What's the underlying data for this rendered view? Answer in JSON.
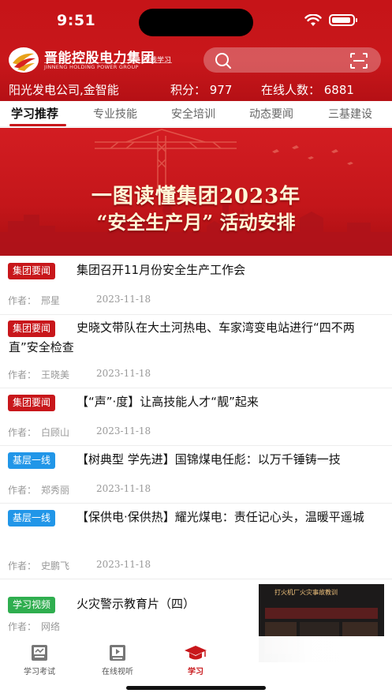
{
  "status_bar": {
    "time": "9:51"
  },
  "header": {
    "brand_name": "晋能控股电力集团",
    "brand_en": "JINNENG HOLDING POWER GROUP",
    "brand_tag": "在线学习",
    "company_user": "阳光发电公司,金智能",
    "points": "积分：  977",
    "online": "在线人数：  6881"
  },
  "tabs": [
    {
      "label": "学习推荐",
      "active": true
    },
    {
      "label": "专业技能",
      "active": false
    },
    {
      "label": "安全培训",
      "active": false
    },
    {
      "label": "动态要闻",
      "active": false
    },
    {
      "label": "三基建设",
      "active": false
    }
  ],
  "banner": {
    "title": "一图读懂集团2023年",
    "subtitle": "“安全生产月” 活动安排"
  },
  "news": [
    {
      "tag": "集团要闻",
      "tag_color": "#c8171b",
      "title": "集团召开11月份安全生产工作会",
      "author_label": "作者：",
      "author": "邢星",
      "date": "2023-11-18"
    },
    {
      "tag": "集团要闻",
      "tag_color": "#c8171b",
      "title": "史晓文带队在大土河热电、车家湾变电站进行“四不两直”安全检查",
      "author_label": "作者：",
      "author": "王晓美",
      "date": "2023-11-18"
    },
    {
      "tag": "集团要闻",
      "tag_color": "#c8171b",
      "title": "【“声”·度】让高技能人才“靓”起来",
      "author_label": "作者：",
      "author": "白顾山",
      "date": "2023-11-18"
    },
    {
      "tag": "基层一线",
      "tag_color": "#2196e8",
      "title": "【树典型 学先进】国锦煤电任彪：以万千锤铸一技",
      "author_label": "作者：",
      "author": "郑秀丽",
      "date": "2023-11-18"
    },
    {
      "tag": "基层一线",
      "tag_color": "#2196e8",
      "title": "【保供电·保供热】耀光煤电：责任记心头，温暖平遥城",
      "author_label": "作者：",
      "author": "史鹏飞",
      "date": "2023-11-18"
    },
    {
      "tag": "学习视频",
      "tag_color": "#2fae4f",
      "title": "火灾警示教育片（四）",
      "author_label": "作者：",
      "author": "网络",
      "video_caption": "打火机厂火灾事故教训"
    }
  ],
  "bottom_nav": [
    {
      "label": "学习考试",
      "icon": "exam-icon",
      "active": false
    },
    {
      "label": "在线视听",
      "icon": "video-icon",
      "active": false
    },
    {
      "label": "学习",
      "icon": "graduation-cap-icon",
      "active": true
    }
  ],
  "colors": {
    "brand_red": "#c8171b",
    "tag_blue": "#2196e8",
    "tag_green": "#2fae4f"
  }
}
